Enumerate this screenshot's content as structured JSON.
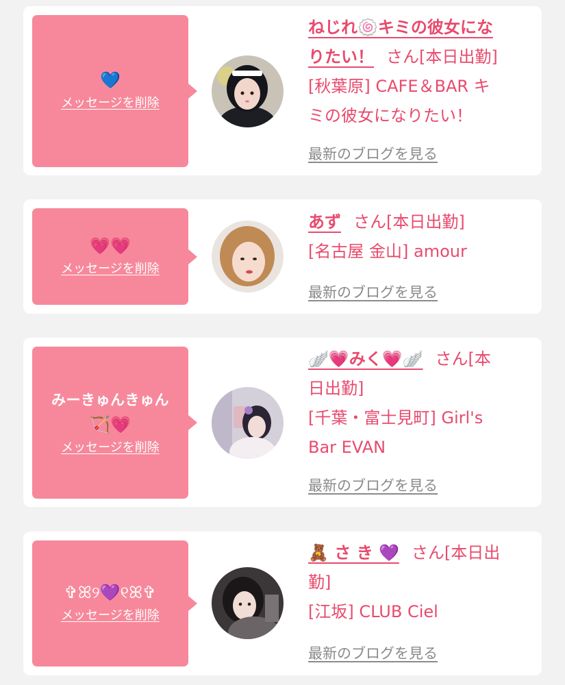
{
  "cards": [
    {
      "message": "💙",
      "delete_label": "メッセージを削除",
      "name_line1": "ねじれ🍥キミの彼女にな",
      "name_line2": "りたい！",
      "san_line2": "さん[本日出勤]",
      "shop_line1": "[秋葉原] CAFE＆BAR キ",
      "shop_line2": "ミの彼女になりたい！",
      "blog_label": "最新のブログを見る"
    },
    {
      "message": "💗💗",
      "delete_label": "メッセージを削除",
      "name": "あず",
      "san": "さん[本日出勤]",
      "shop": "[名古屋 金山] amour",
      "blog_label": "最新のブログを見る"
    },
    {
      "message_line1": "みーきゅんきゅん",
      "message_line2": "🏹💗",
      "delete_label": "メッセージを削除",
      "name": "🪽💗みく💗🪽",
      "san_line1": "さん[本",
      "san_line2": "日出勤]",
      "shop_line1": "[千葉・富士見町] Girl's",
      "shop_line2": "Bar EVAN",
      "blog_label": "最新のブログを見る"
    },
    {
      "message": "✞ꕤ୨💜୧ꕤ✞",
      "delete_label": "メッセージを削除",
      "name": "🧸 さ き 💜",
      "san_line1": "さん[本日出",
      "san_line2": "勤]",
      "shop": "[江坂] CLUB Ciel",
      "blog_label": "最新のブログを見る"
    }
  ],
  "colors": {
    "bubble": "#f7889b",
    "accent_text": "#e84a6d",
    "link_gray": "#8a8a8a",
    "card_bg": "#ffffff",
    "page_bg": "#f2f2f2"
  }
}
